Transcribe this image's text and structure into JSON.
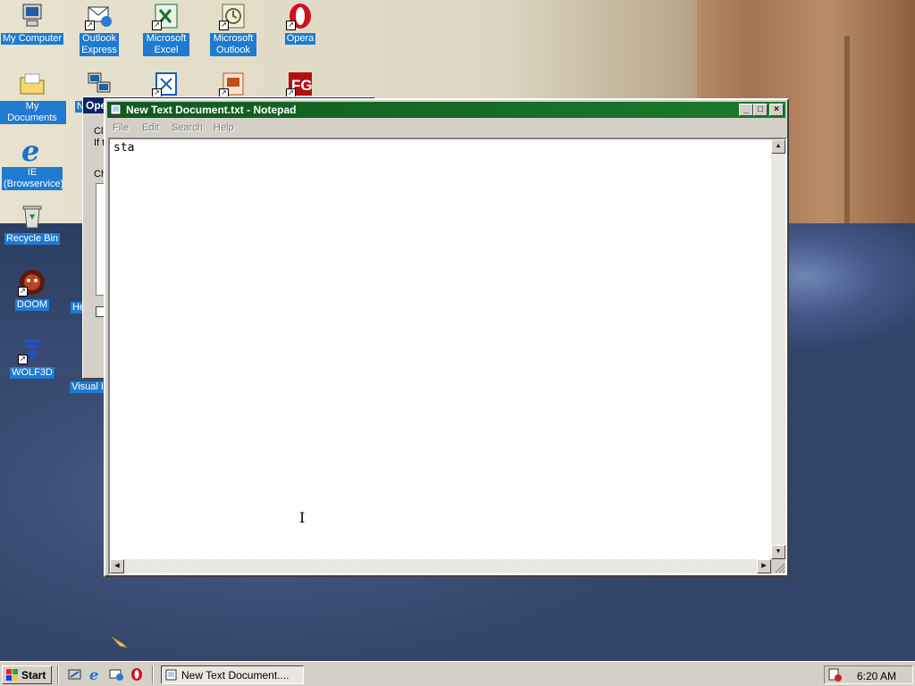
{
  "desktop": {
    "icons": [
      {
        "label": "My Computer"
      },
      {
        "label": "Outlook Express"
      },
      {
        "label": "Microsoft Excel"
      },
      {
        "label": "Microsoft Outlook"
      },
      {
        "label": "Opera"
      },
      {
        "label": "My Documents"
      },
      {
        "label": "Ne"
      },
      {
        "label": "IE (Browservice)"
      },
      {
        "label": "Recycle Bin"
      },
      {
        "label": "DOOM"
      },
      {
        "label": "He"
      },
      {
        "label": "WOLF3D"
      },
      {
        "label": "Visual I"
      }
    ]
  },
  "background_dialog": {
    "title": "Ope",
    "lines": [
      "Cli",
      "If t",
      "Ch"
    ]
  },
  "notepad": {
    "title": "New Text Document.txt - Notepad",
    "menu": [
      "File",
      "Edit",
      "Search",
      "Help"
    ],
    "content": "sta",
    "buttons": {
      "minimize": "_",
      "maximize": "□",
      "close": "×"
    }
  },
  "taskbar": {
    "start_label": "Start",
    "task_label": "New Text Document....",
    "clock": "6:20 AM"
  },
  "colors": {
    "active_title": "#1c7a2b",
    "selection": "#1e7bd0",
    "face": "#d4d0c8"
  }
}
